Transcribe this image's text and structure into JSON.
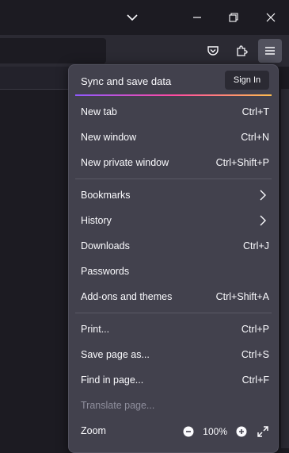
{
  "menu": {
    "sync_label": "Sync and save data",
    "signin_label": "Sign In",
    "items": [
      {
        "label": "New tab",
        "shortcut": "Ctrl+T"
      },
      {
        "label": "New window",
        "shortcut": "Ctrl+N"
      },
      {
        "label": "New private window",
        "shortcut": "Ctrl+Shift+P"
      },
      {
        "label": "Bookmarks",
        "shortcut": ""
      },
      {
        "label": "History",
        "shortcut": ""
      },
      {
        "label": "Downloads",
        "shortcut": "Ctrl+J"
      },
      {
        "label": "Passwords",
        "shortcut": ""
      },
      {
        "label": "Add-ons and themes",
        "shortcut": "Ctrl+Shift+A"
      },
      {
        "label": "Print...",
        "shortcut": "Ctrl+P"
      },
      {
        "label": "Save page as...",
        "shortcut": "Ctrl+S"
      },
      {
        "label": "Find in page...",
        "shortcut": "Ctrl+F"
      },
      {
        "label": "Translate page...",
        "shortcut": ""
      },
      {
        "label": "Zoom",
        "shortcut": ""
      }
    ],
    "zoom_value": "100%"
  },
  "colors": {
    "menu_bg": "#42414d",
    "chrome_bg": "#1c1b22",
    "accent_gradient": [
      "#9059ff",
      "#ff4aa2",
      "#ffbd4f"
    ]
  },
  "icons": {
    "titlebar": [
      "tabs-list-chevron-icon",
      "minimize-icon",
      "restore-icon",
      "close-icon"
    ],
    "toolbar": [
      "pocket-icon",
      "extensions-icon",
      "hamburger-menu-icon"
    ]
  }
}
